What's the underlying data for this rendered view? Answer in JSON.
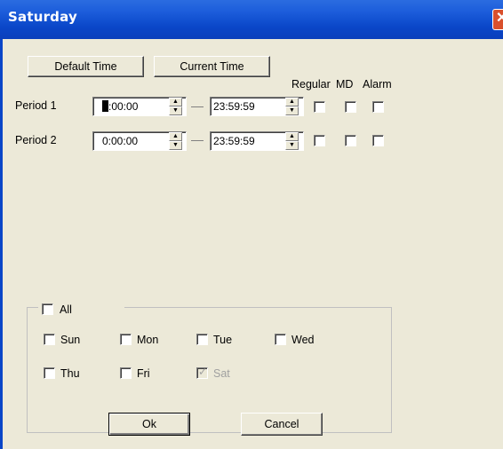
{
  "window": {
    "title": "Saturday",
    "close_glyph": "✕"
  },
  "toolbar": {
    "default_time_label": "Default Time",
    "current_time_label": "Current Time"
  },
  "columns": {
    "regular": "Regular",
    "md": "MD",
    "alarm": "Alarm"
  },
  "periods": [
    {
      "label": "Period 1",
      "start_rest": ":00:00",
      "start_caret_char": "0",
      "end": "23:59:59",
      "regular": false,
      "md": false,
      "alarm": false
    },
    {
      "label": "Period 2",
      "start": "0:00:00",
      "end": "23:59:59",
      "regular": false,
      "md": false,
      "alarm": false
    }
  ],
  "days": {
    "all": {
      "label": "All",
      "checked": false
    },
    "sun": {
      "label": "Sun",
      "checked": false
    },
    "mon": {
      "label": "Mon",
      "checked": false
    },
    "tue": {
      "label": "Tue",
      "checked": false
    },
    "wed": {
      "label": "Wed",
      "checked": false
    },
    "thu": {
      "label": "Thu",
      "checked": false
    },
    "fri": {
      "label": "Fri",
      "checked": false
    },
    "sat": {
      "label": "Sat",
      "checked": true,
      "disabled": true
    }
  },
  "footer": {
    "ok_label": "Ok",
    "cancel_label": "Cancel"
  },
  "icons": {
    "spin_up": "▲",
    "spin_down": "▼",
    "check": "✓"
  },
  "colors": {
    "titlebar": "#0a46c8",
    "face": "#ece9d8",
    "close": "#d9502c"
  }
}
